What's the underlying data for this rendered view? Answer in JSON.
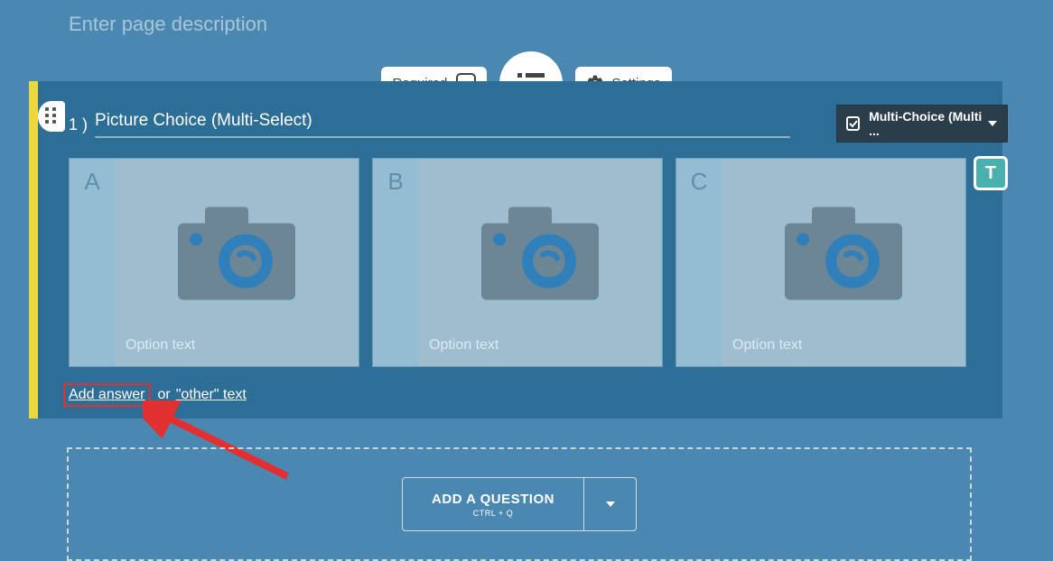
{
  "page_description_placeholder": "Enter page description",
  "toolbar": {
    "required_label": "Required",
    "settings_label": "Settings"
  },
  "question": {
    "number": "1 )",
    "title": "Picture Choice (Multi-Select)",
    "type_dropdown_label": "Multi-Choice (Multi ...",
    "options": [
      {
        "letter": "A",
        "placeholder": "Option text"
      },
      {
        "letter": "B",
        "placeholder": "Option text"
      },
      {
        "letter": "C",
        "placeholder": "Option text"
      }
    ],
    "t_badge": "T"
  },
  "footer": {
    "add_answer": "Add answer",
    "or": " or ",
    "other_text": "\"other\" text"
  },
  "add_question": {
    "label": "ADD A QUESTION",
    "hint": "CTRL + Q"
  }
}
